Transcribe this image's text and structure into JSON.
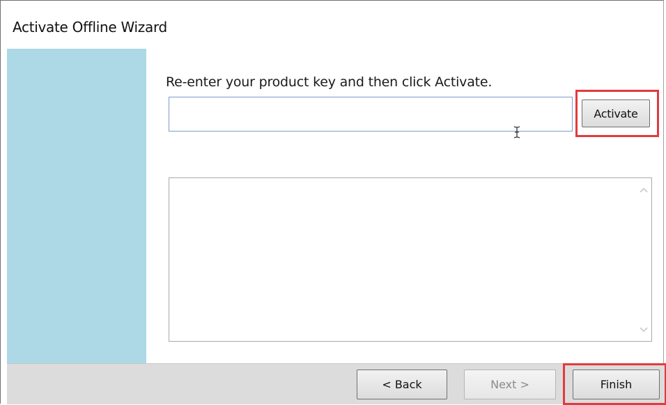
{
  "window": {
    "title": "Activate Offline Wizard"
  },
  "main": {
    "instruction": "Re-enter your product key and then click Activate.",
    "product_key_value": "",
    "activate_label": "Activate",
    "result_text": ""
  },
  "footer": {
    "back_label": "< Back",
    "next_label": "Next >",
    "next_enabled": false,
    "finish_label": "Finish"
  },
  "colors": {
    "side_panel": "#add8e6",
    "highlight_outline": "#e23a3e",
    "footer_background": "#dcdcdc"
  },
  "icons": [
    "text-cursor-icon",
    "scroll-up-icon",
    "scroll-down-icon"
  ]
}
